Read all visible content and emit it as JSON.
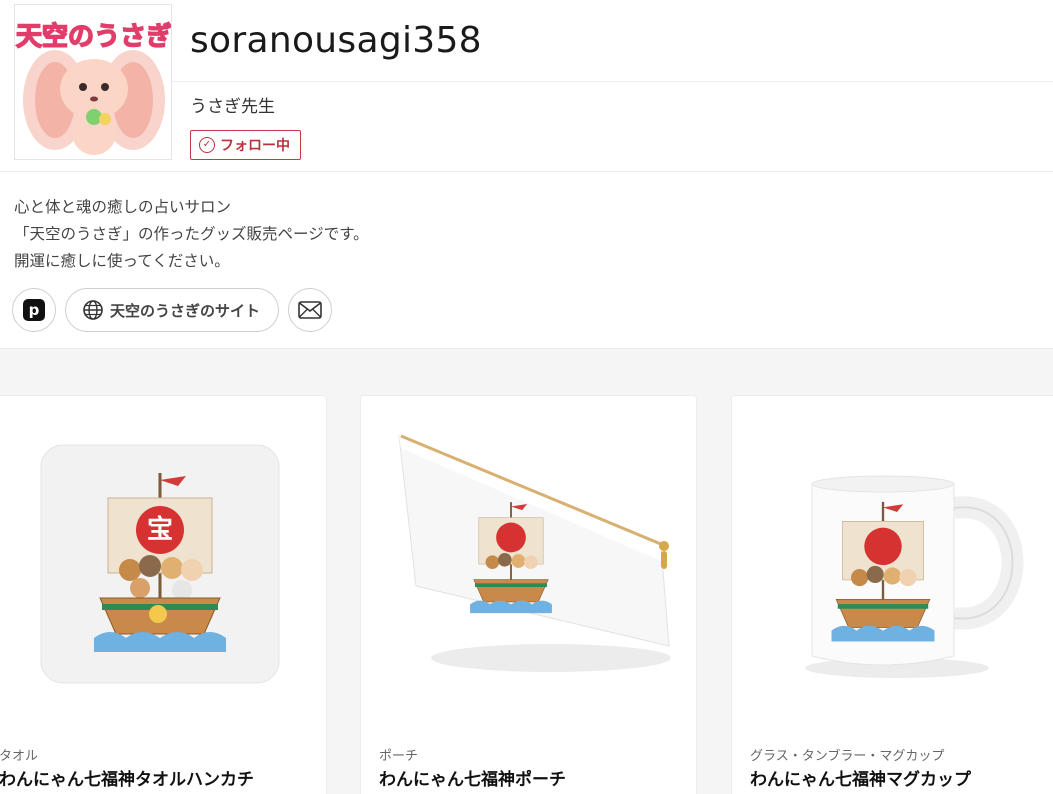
{
  "profile": {
    "username": "soranousagi358",
    "display_name": "うさぎ先生",
    "avatar_text": "天空のうさぎ",
    "follow_label": "フォロー中"
  },
  "bio": {
    "lines": [
      "心と体と魂の癒しの占いサロン",
      "「天空のうさぎ」の作ったグッズ販売ページです。",
      "開運に癒しに使ってください。"
    ]
  },
  "links": {
    "pixiv_icon": "p",
    "website_label": "天空のうさぎのサイト",
    "icons": [
      "pixiv-icon",
      "globe-icon",
      "mail-icon"
    ]
  },
  "products": [
    {
      "category": "タオル",
      "title": "わんにゃん七福神タオルハンカチ",
      "image": "towel-handkerchief"
    },
    {
      "category": "ポーチ",
      "title": "わんにゃん七福神ポーチ",
      "image": "pouch"
    },
    {
      "category": "グラス・タンブラー・マグカップ",
      "title": "わんにゃん七福神マグカップ",
      "image": "mug"
    }
  ],
  "art": {
    "sail_char": "宝"
  },
  "colors": {
    "accent": "#b8323d",
    "border": "#cfcfcf",
    "background": "#f5f5f5"
  }
}
